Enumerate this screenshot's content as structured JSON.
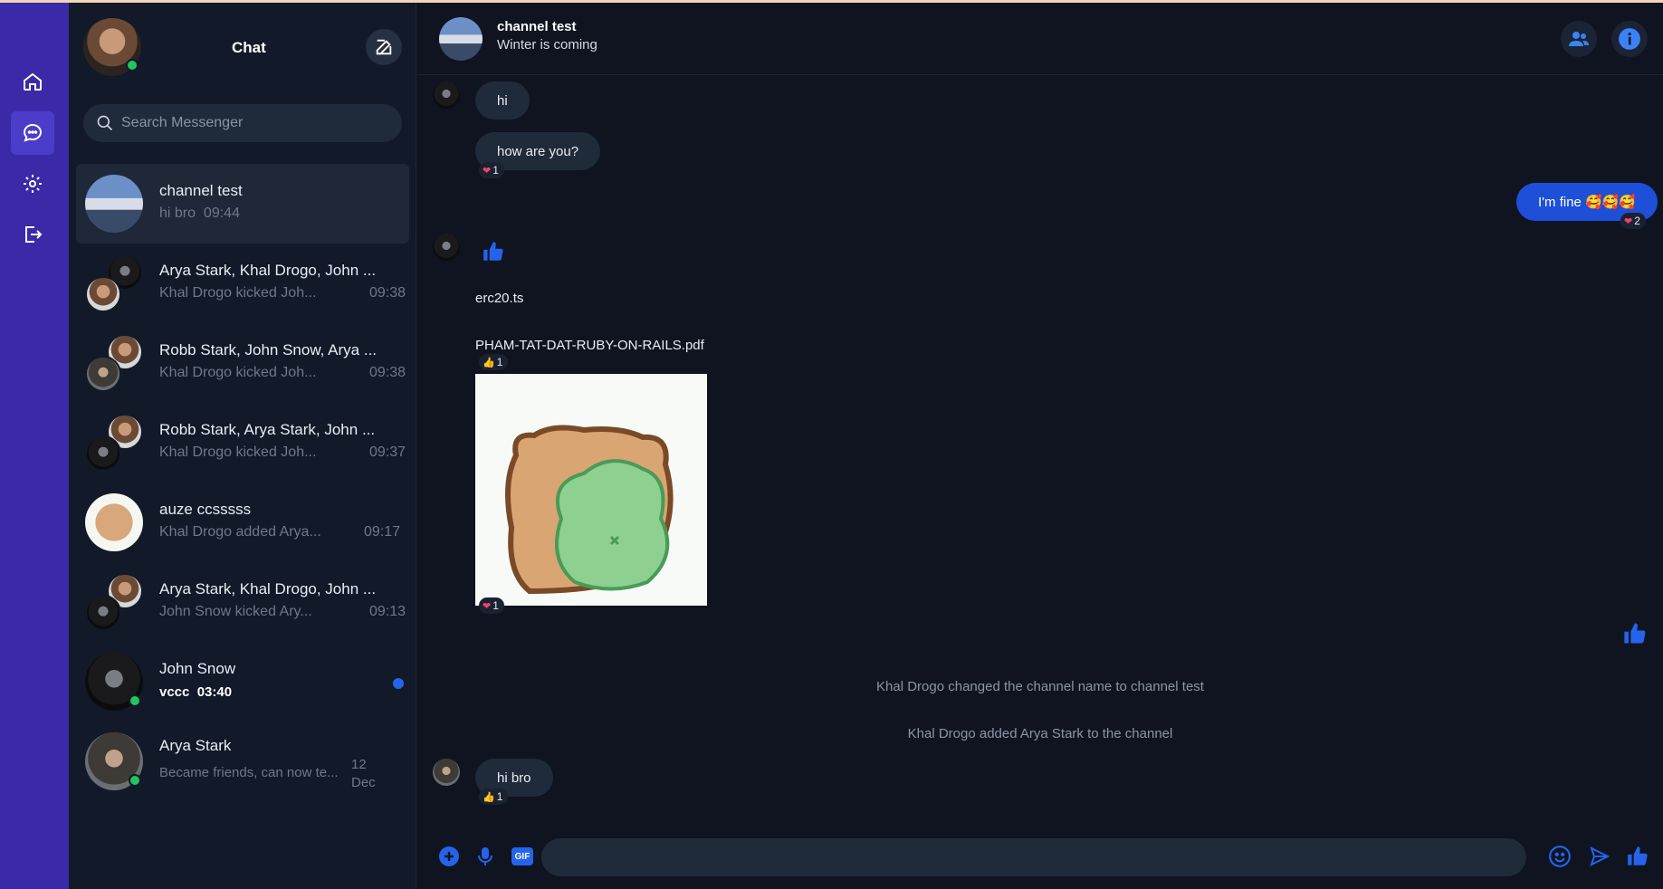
{
  "nav": {
    "items": [
      {
        "name": "home",
        "icon": "home-icon",
        "active": false
      },
      {
        "name": "chat",
        "icon": "chat-icon",
        "active": true
      },
      {
        "name": "settings",
        "icon": "gear-icon",
        "active": false
      },
      {
        "name": "logout",
        "icon": "logout-icon",
        "active": false
      }
    ]
  },
  "sidebar": {
    "title": "Chat",
    "search_placeholder": "Search Messenger",
    "conversations": [
      {
        "name": "channel test",
        "preview": "hi bro",
        "time": "09:44",
        "active": true
      },
      {
        "name": "Arya Stark, Khal Drogo, John ...",
        "preview": "Khal Drogo kicked Joh...",
        "time": "09:38"
      },
      {
        "name": "Robb Stark, John Snow, Arya ...",
        "preview": "Khal Drogo kicked Joh...",
        "time": "09:38"
      },
      {
        "name": "Robb Stark, Arya Stark, John ...",
        "preview": "Khal Drogo kicked Joh...",
        "time": "09:37"
      },
      {
        "name": "auze ccsssss",
        "preview": "Khal Drogo added Arya...",
        "time": "09:17"
      },
      {
        "name": "Arya Stark, Khal Drogo, John ...",
        "preview": "John Snow kicked Ary...",
        "time": "09:13"
      },
      {
        "name": "John Snow",
        "preview": "vccc",
        "time": "03:40",
        "unread": true,
        "online": true
      },
      {
        "name": "Arya Stark",
        "preview": "Became friends, can now te...",
        "time_day": "12",
        "time_month": "Dec",
        "online": true
      }
    ]
  },
  "chat": {
    "name": "channel test",
    "status": "Winter is coming",
    "messages": [
      {
        "text": "hi"
      },
      {
        "text": "how are you?",
        "reaction": "1"
      },
      {
        "text": "I'm fine 🥰🥰🥰",
        "mine": true,
        "reaction": "2"
      },
      {
        "file": "erc20.ts"
      },
      {
        "file": "PHAM-TAT-DAT-RUBY-ON-RAILS.pdf",
        "reaction": "1"
      },
      {
        "sticker": "bear-sticker",
        "reaction": "1"
      },
      {
        "text": "hi bro",
        "reaction": "1"
      }
    ],
    "system": [
      "Khal Drogo changed the channel name to channel test",
      "Khal Drogo added Arya Stark to the channel"
    ]
  },
  "composer": {
    "gif_label": "GIF",
    "input_value": ""
  },
  "colors": {
    "rail": "#3a2aa8",
    "accent": "#1d4fd8",
    "online": "#22c55e",
    "heart": "#ef4466"
  }
}
